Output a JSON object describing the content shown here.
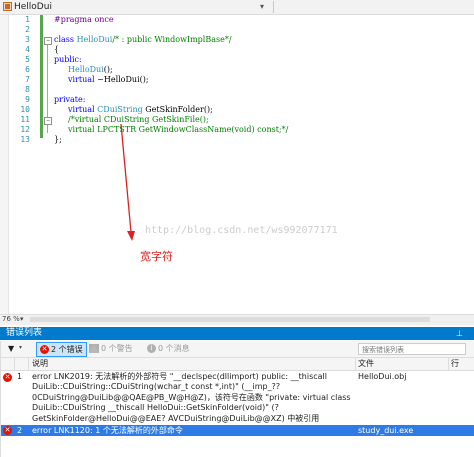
{
  "editor_bar": {
    "scope_label": "HelloDui"
  },
  "editor": {
    "line_numbers": [
      "1",
      "2",
      "3",
      "4",
      "5",
      "6",
      "7",
      "8",
      "9",
      "10",
      "11",
      "12",
      "13"
    ],
    "code": {
      "l1_directive": "#pragma once",
      "l3_kw": "class",
      "l3_name": " HelloDui",
      "l3_comment": "/* : public WindowImplBase*/",
      "l4": "{",
      "l5": "public:",
      "l6_name": "HelloDui",
      "l6_rest": "();",
      "l7_kw": "virtual",
      "l7_rest": " ~HelloDui();",
      "l9": "private:",
      "l10_kw": "virtual",
      "l10_type": " CDuiString",
      "l10_rest": " GetSkinFolder();",
      "l11": "/*virtual CDuiString GetSkinFile();",
      "l12": "virtual LPCTSTR GetWindowClassName(void) const;*/",
      "l13": "};"
    },
    "watermark": "http://blog.csdn.net/ws992077171",
    "annotation": "宽字符"
  },
  "zoom": {
    "level": "76 %"
  },
  "error_panel": {
    "title": "错误列表",
    "errors_button": "2 个错误",
    "errors_badge": "✕",
    "warnings_button": "0 个警告",
    "messages_button": "0 个消息",
    "search_placeholder": "搜索错误列表",
    "columns": {
      "description": "说明",
      "file": "文件",
      "line": "行"
    },
    "rows": [
      {
        "number": "1",
        "description": "error LNK2019: 无法解析的外部符号 \"__declspec(dllimport) public: __thiscall DuiLib::CDuiString::CDuiString(wchar_t const *,int)\" (__imp_?? 0CDuiString@DuiLib@@QAE@PB_W@H@Z)，该符号在函数 \"private: virtual class DuiLib::CDuiString __thiscall HelloDui::GetSkinFolder(void)\" (?GetSkinFolder@HelloDui@@EAE? AVCDuiString@DuiLib@@XZ) 中被引用",
        "file": "HelloDui.obj"
      },
      {
        "number": "2",
        "description": "error LNK1120: 1 个无法解析的外部命令",
        "file": "study_dui.exe"
      }
    ]
  },
  "colors": {
    "panel_title_bg": "#007acc",
    "selected_row_bg": "#2f7be6",
    "error_red": "#e51400",
    "annotation_red": "#e02020",
    "change_bar_green": "#57a64a"
  }
}
